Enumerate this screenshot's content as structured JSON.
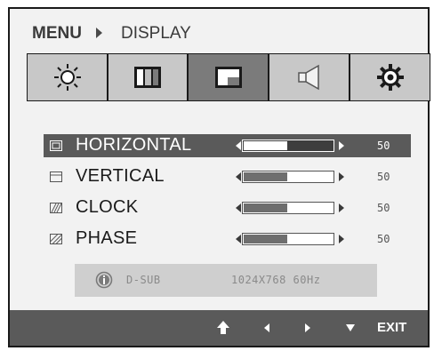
{
  "breadcrumb": {
    "menu": "MENU",
    "current": "DISPLAY"
  },
  "tabs": [
    {
      "name": "brightness",
      "icon": "sun-icon"
    },
    {
      "name": "color",
      "icon": "color-bars-icon"
    },
    {
      "name": "display",
      "icon": "display-icon",
      "active": true
    },
    {
      "name": "audio",
      "icon": "speaker-icon"
    },
    {
      "name": "settings",
      "icon": "gear-icon"
    }
  ],
  "settings": [
    {
      "label": "HORIZONTAL",
      "value": "50",
      "level": 0.5,
      "icon": "horizontal-position-icon",
      "selected": true
    },
    {
      "label": "VERTICAL",
      "value": "50",
      "level": 0.5,
      "icon": "vertical-position-icon"
    },
    {
      "label": "CLOCK",
      "value": "50",
      "level": 0.5,
      "icon": "clock-icon"
    },
    {
      "label": "PHASE",
      "value": "50",
      "level": 0.5,
      "icon": "phase-icon"
    }
  ],
  "info": {
    "source": "D-SUB",
    "resolution": "1024X768  60Hz",
    "icon": "info-icon"
  },
  "footer": {
    "buttons": [
      "up-arrow-icon",
      "left-arrow-icon",
      "right-arrow-icon",
      "down-arrow-icon"
    ],
    "exit_label": "EXIT"
  },
  "colors": {
    "panel": "#f2f2f2",
    "tab": "#c8c8c8",
    "tab_active": "#7b7b7b",
    "selected_row": "#5a5a5a",
    "footer": "#5a5a5a"
  }
}
